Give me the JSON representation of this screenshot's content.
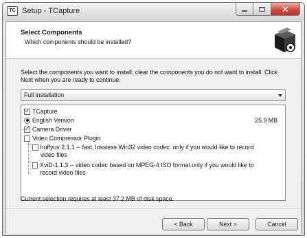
{
  "window": {
    "title": "Setup - TCapture",
    "icon_label": "TC",
    "icon": "tcapture-app-icon",
    "caption_icons": [
      "minimize-icon",
      "maximize-icon",
      "close-icon"
    ],
    "close_glyph": "✕"
  },
  "header": {
    "title": "Select Components",
    "subtitle": "Which components should be installed?",
    "graphic": "installer-box-graphic"
  },
  "instructions": "Select the components you want to install; clear the components you do not want to install. Click Next when you are ready to continue.",
  "install_type": {
    "selected": "Full installation",
    "icon": "chevron-down-icon"
  },
  "components": [
    {
      "label": "TCapture",
      "control": "checkbox",
      "checked": true,
      "size": ""
    },
    {
      "label": "English Version",
      "control": "radio",
      "checked": true,
      "size": "25.9 MB"
    },
    {
      "label": "Camera Driver",
      "control": "checkbox",
      "checked": true,
      "size": ""
    },
    {
      "label": "Video Compressor Plugin",
      "control": "checkbox",
      "checked": false,
      "size": ""
    },
    {
      "label": "huffyuv 2.1.1 -- fast, lossless Win32 video codec. only if you would like to record video files",
      "control": "checkbox",
      "checked": false,
      "size": ""
    },
    {
      "label": "XviD-1.1.3 -- video codec based on MPEG-4 ISO format.only if you would like to record video files",
      "control": "checkbox",
      "checked": false,
      "size": ""
    }
  ],
  "check_glyph": "✓",
  "disk_space_note": "Current selection requires at least 37.2 MB of disk space.",
  "buttons": {
    "back": "< Back",
    "next": "Next >",
    "cancel": "Cancel"
  },
  "colors": {
    "window_chrome": "#d9d9d9",
    "panel": "#f0f0f0",
    "close_button": "#c8473a"
  }
}
